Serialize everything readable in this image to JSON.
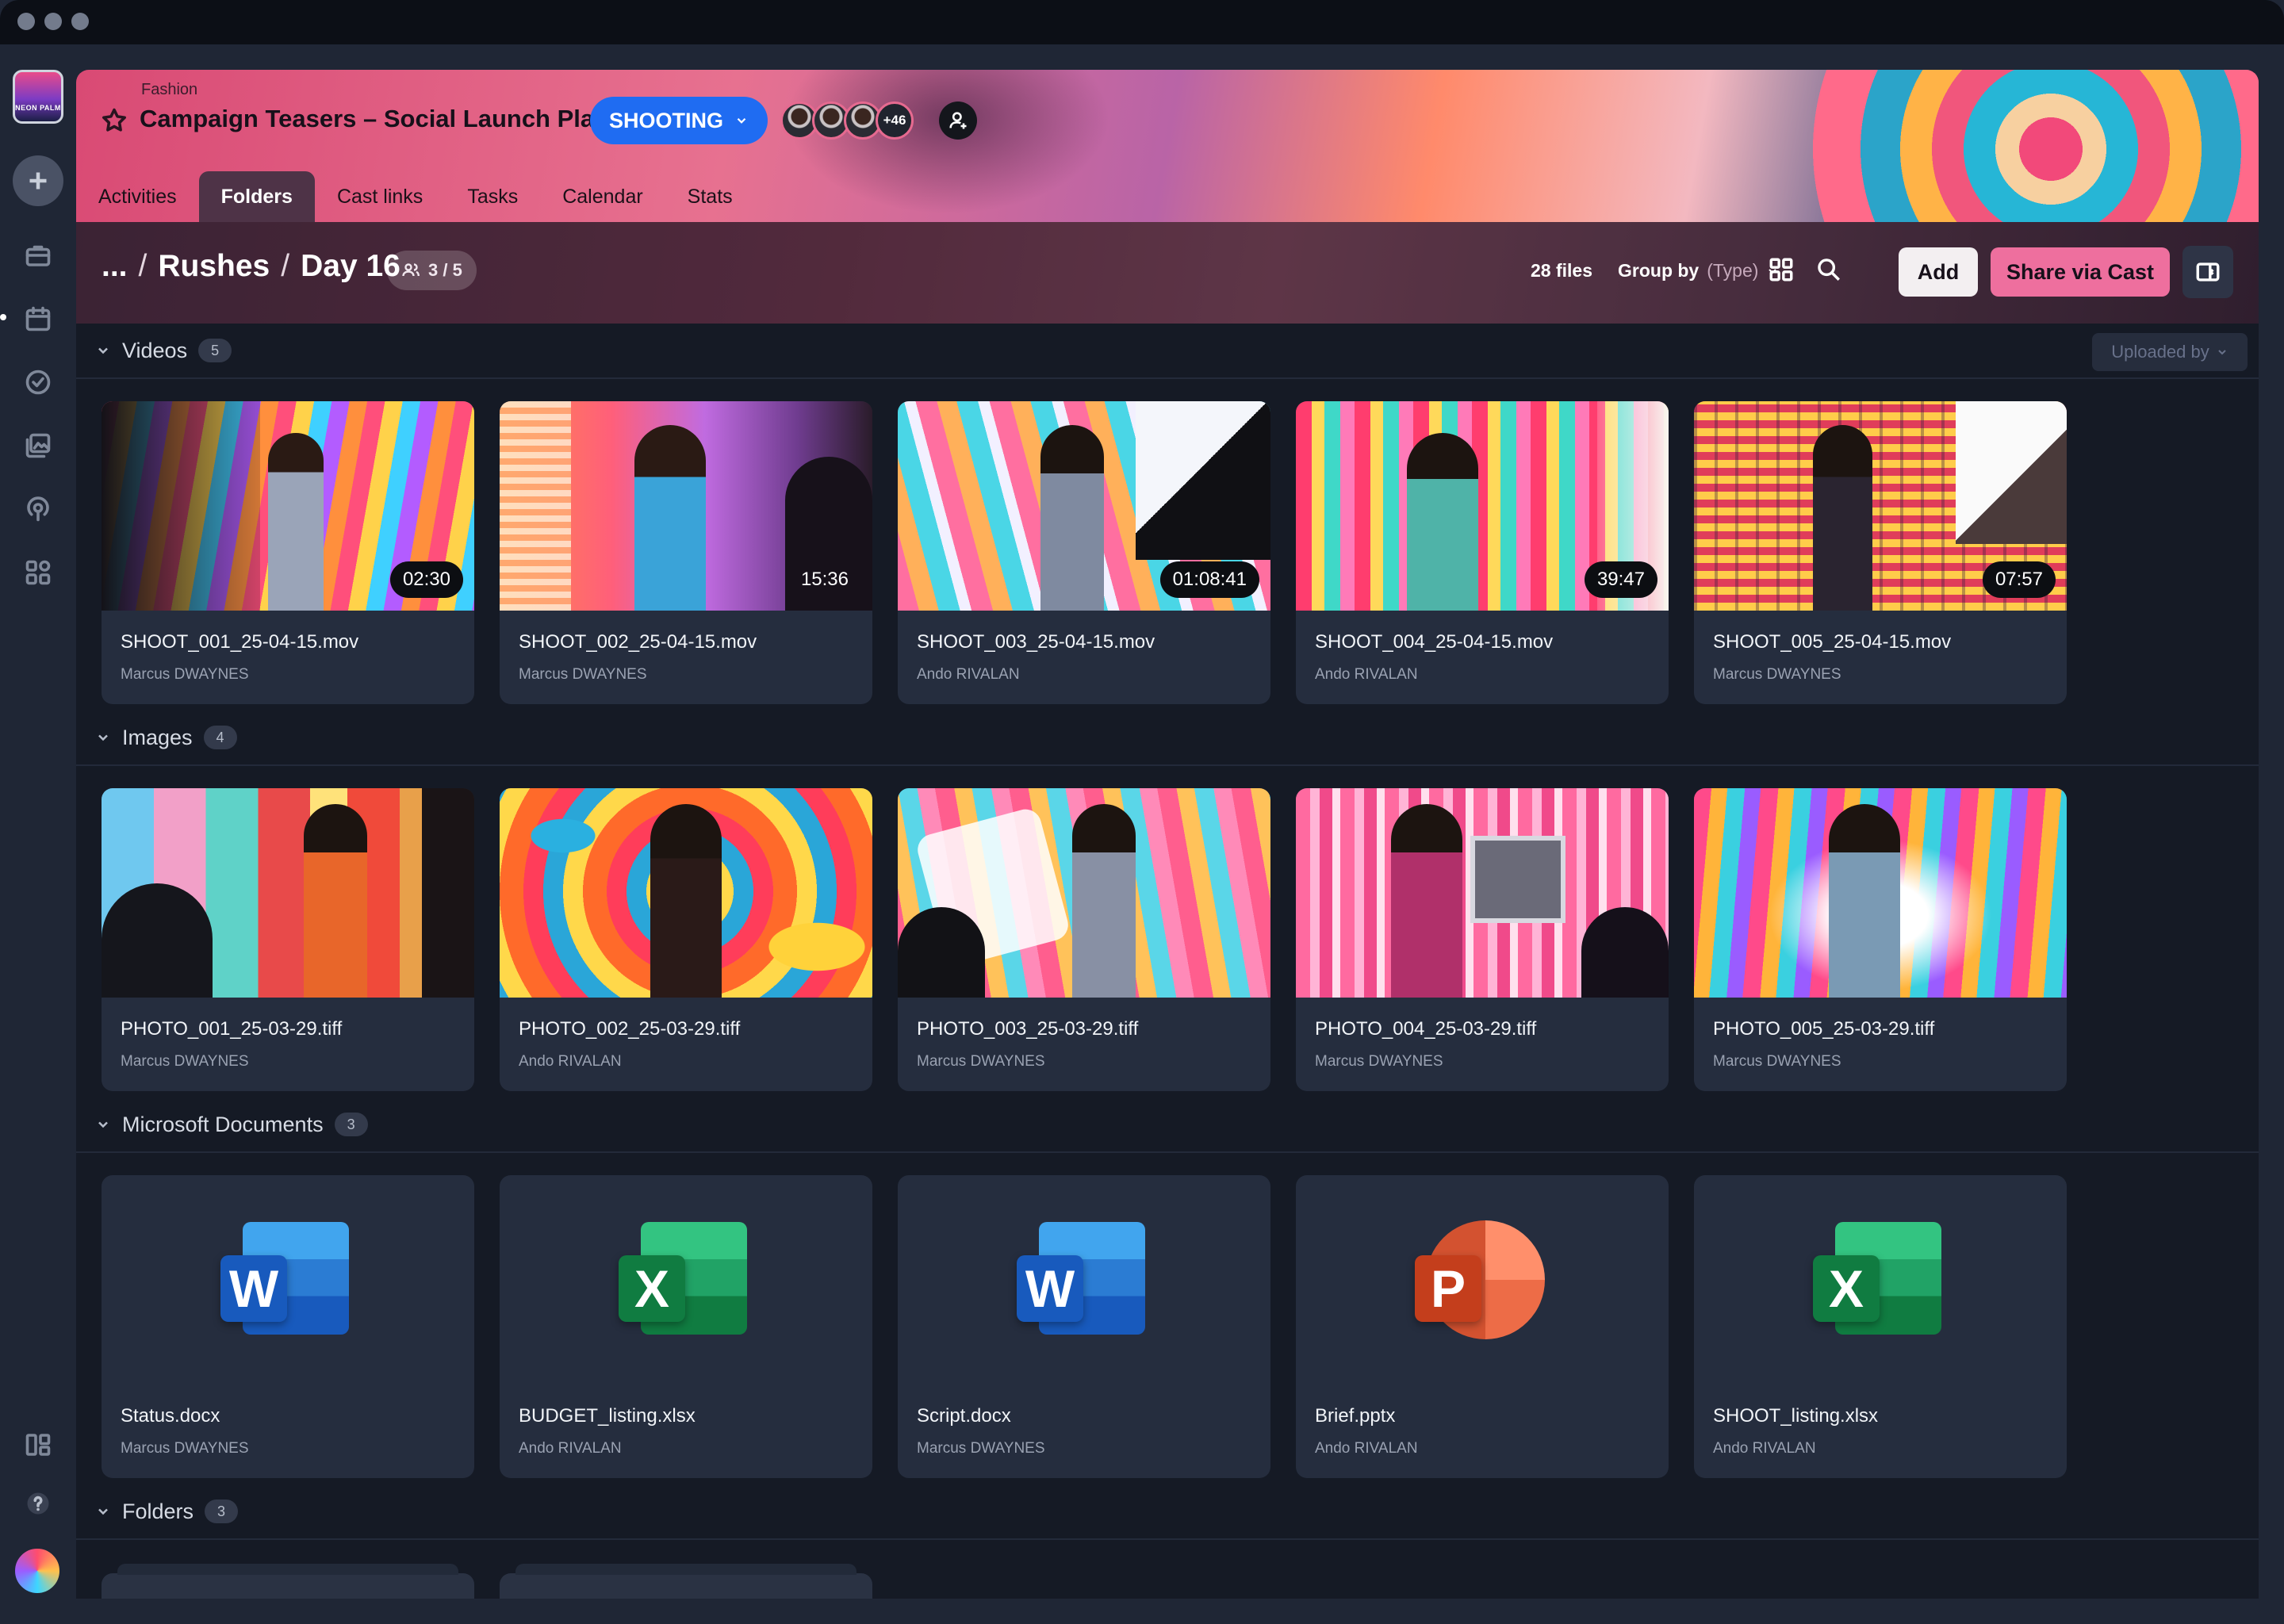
{
  "app": {
    "window_dots": [
      "",
      "",
      ""
    ]
  },
  "project": {
    "category": "Fashion",
    "title": "Campaign Teasers – Social Launch Plan",
    "status": "SHOOTING",
    "extra_members": "+46"
  },
  "tabs": [
    {
      "label": "Activities",
      "active": false
    },
    {
      "label": "Folders",
      "active": true
    },
    {
      "label": "Cast links",
      "active": false
    },
    {
      "label": "Tasks",
      "active": false
    },
    {
      "label": "Calendar",
      "active": false
    },
    {
      "label": "Stats",
      "active": false
    }
  ],
  "toolbar": {
    "breadcrumb_root": "...",
    "breadcrumb_parent": "Rushes",
    "breadcrumb_current": "Day 16",
    "access": "3 / 5",
    "file_count": "28 files",
    "group_by_label": "Group by",
    "group_by_value": "(Type)",
    "add_label": "Add",
    "share_label": "Share via Cast",
    "uploaded_by": "Uploaded by"
  },
  "sections": {
    "videos": {
      "title": "Videos",
      "count": "5"
    },
    "images": {
      "title": "Images",
      "count": "4"
    },
    "docs": {
      "title": "Microsoft Documents",
      "count": "3"
    },
    "folders": {
      "title": "Folders",
      "count": "3"
    }
  },
  "videos": [
    {
      "name": "SHOOT_001_25-04-15.mov",
      "owner": "Marcus DWAYNES",
      "duration": "02:30"
    },
    {
      "name": "SHOOT_002_25-04-15.mov",
      "owner": "Marcus DWAYNES",
      "duration": "15:36"
    },
    {
      "name": "SHOOT_003_25-04-15.mov",
      "owner": "Ando RIVALAN",
      "duration": "01:08:41"
    },
    {
      "name": "SHOOT_004_25-04-15.mov",
      "owner": "Ando RIVALAN",
      "duration": "39:47"
    },
    {
      "name": "SHOOT_005_25-04-15.mov",
      "owner": "Marcus DWAYNES",
      "duration": "07:57"
    }
  ],
  "images": [
    {
      "name": "PHOTO_001_25-03-29.tiff",
      "owner": "Marcus DWAYNES"
    },
    {
      "name": "PHOTO_002_25-03-29.tiff",
      "owner": "Ando RIVALAN"
    },
    {
      "name": "PHOTO_003_25-03-29.tiff",
      "owner": "Marcus DWAYNES"
    },
    {
      "name": "PHOTO_004_25-03-29.tiff",
      "owner": "Marcus DWAYNES"
    },
    {
      "name": "PHOTO_005_25-03-29.tiff",
      "owner": "Marcus DWAYNES"
    }
  ],
  "docs": [
    {
      "name": "Status.docx",
      "owner": "Marcus DWAYNES",
      "letter": "W",
      "icon": "word-icon"
    },
    {
      "name": "BUDGET_listing.xlsx",
      "owner": "Ando RIVALAN",
      "letter": "X",
      "icon": "excel-icon"
    },
    {
      "name": "Script.docx",
      "owner": "Marcus DWAYNES",
      "letter": "W",
      "icon": "word-icon"
    },
    {
      "name": "Brief.pptx",
      "owner": "Ando RIVALAN",
      "letter": "P",
      "icon": "powerpoint-icon"
    },
    {
      "name": "SHOOT_listing.xlsx",
      "owner": "Ando RIVALAN",
      "letter": "X",
      "icon": "excel-icon"
    }
  ],
  "colors": {
    "accent_blue": "#1f6cf2",
    "share_pink": "#ee6f9e",
    "word_blue": "#185abd",
    "excel_green": "#107c41",
    "ppt_orange": "#c43e1c"
  }
}
